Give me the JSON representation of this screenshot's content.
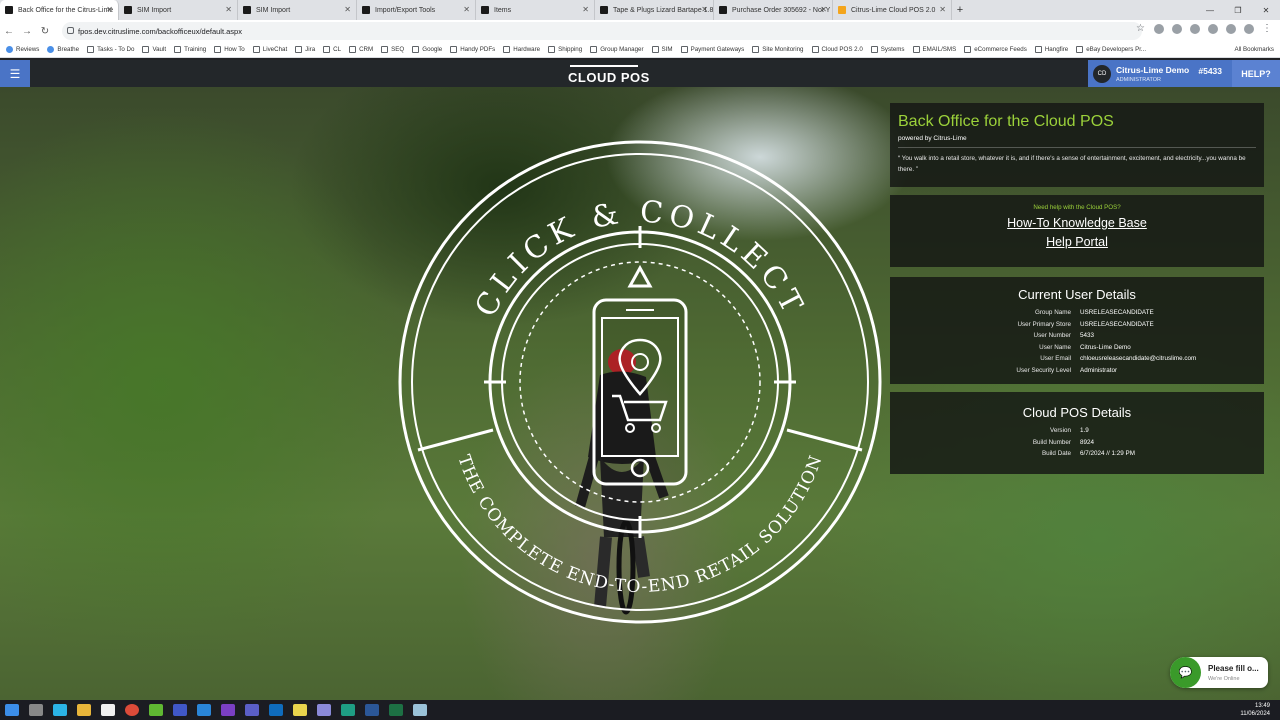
{
  "browser": {
    "tabs": [
      {
        "label": "Back Office for the Citrus-Lime",
        "active": true
      },
      {
        "label": "SIM Import"
      },
      {
        "label": "SIM Import"
      },
      {
        "label": "Import/Export Tools"
      },
      {
        "label": "Items"
      },
      {
        "label": "Tape & Plugs Lizard Bartape 1.8"
      },
      {
        "label": "Purchase Order 305692 - Not Y"
      },
      {
        "label": "Citrus-Lime Cloud POS 2.0"
      }
    ],
    "url": "fpos.dev.citruslime.com/backofficeux/default.aspx",
    "bookmarks": [
      "Reviews",
      "Breathe",
      "Tasks - To Do",
      "Vault",
      "Training",
      "How To",
      "LiveChat",
      "Jira",
      "CL",
      "CRM",
      "SEQ",
      "Google",
      "Handy PDFs",
      "Hardware",
      "Shipping",
      "Group Manager",
      "SIM",
      "Payment Gateways",
      "Site Monitoring",
      "Cloud POS 2.0",
      "Systems",
      "EMAIL/SMS",
      "eCommerce Feeds",
      "Hangfire",
      "eBay Developers Pr..."
    ],
    "all_bookmarks": "All Bookmarks"
  },
  "header": {
    "logo": "CLOUD POS",
    "user_initials": "CD",
    "user_name": "Citrus-Lime Demo",
    "user_role": "ADMINISTRATOR",
    "user_number": "#5433",
    "help": "HELP?"
  },
  "emblem": {
    "top_text": "CLICK & COLLECT",
    "bottom_text": "THE COMPLETE END-TO-END RETAIL SOLUTION"
  },
  "intro": {
    "title": "Back Office for the Cloud POS",
    "subtitle": "powered by Citrus-Lime",
    "quote": "“ You walk into a retail store, whatever it is, and if there's a sense of entertainment, excitement, and electricity...you wanna be there. ”"
  },
  "help_panel": {
    "prompt": "Need help with the Cloud POS?",
    "knowledge_base": "How-To Knowledge Base",
    "help_portal": "Help Portal"
  },
  "user_details": {
    "title": "Current User Details",
    "rows": [
      {
        "label": "Group Name",
        "value": "USRELEASECANDIDATE"
      },
      {
        "label": "User Primary Store",
        "value": "USRELEASECANDIDATE"
      },
      {
        "label": "User Number",
        "value": "5433"
      },
      {
        "label": "User Name",
        "value": "Citrus-Lime Demo"
      },
      {
        "label": "User Email",
        "value": "chloeusreleasecandidate@citruslime.com"
      },
      {
        "label": "User Security Level",
        "value": "Administrator"
      }
    ]
  },
  "pos_details": {
    "title": "Cloud POS Details",
    "rows": [
      {
        "label": "Version",
        "value": "1.9"
      },
      {
        "label": "Build Number",
        "value": "8924"
      },
      {
        "label": "Build Date",
        "value": "6/7/2024 // 1:29 PM"
      }
    ]
  },
  "chat": {
    "title": "Please fill o...",
    "status": "We're Online"
  },
  "taskbar": {
    "time": "13:49",
    "date": "11/06/2024"
  }
}
